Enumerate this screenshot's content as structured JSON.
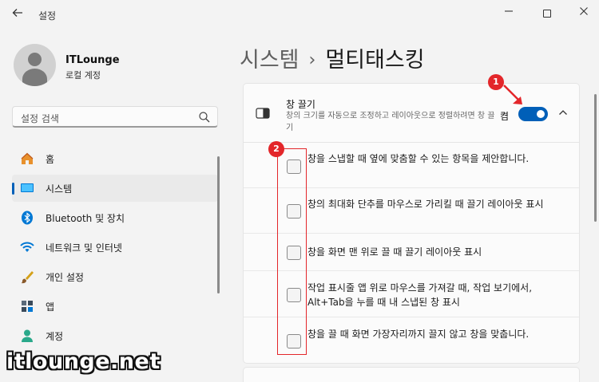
{
  "window": {
    "title": "설정"
  },
  "profile": {
    "name": "ITLounge",
    "account": "로컬 계정"
  },
  "search": {
    "placeholder": "설정 검색"
  },
  "sidebar": {
    "items": [
      {
        "label": "홈",
        "icon": "home-icon"
      },
      {
        "label": "시스템",
        "icon": "system-icon",
        "active": true
      },
      {
        "label": "Bluetooth 및 장치",
        "icon": "bluetooth-icon"
      },
      {
        "label": "네트워크 및 인터넷",
        "icon": "wifi-icon"
      },
      {
        "label": "개인 설정",
        "icon": "brush-icon"
      },
      {
        "label": "앱",
        "icon": "apps-icon"
      },
      {
        "label": "계정",
        "icon": "account-icon"
      }
    ]
  },
  "breadcrumb": {
    "parent": "시스템",
    "separator": "›",
    "current": "멀티태스킹"
  },
  "snap": {
    "title": "창 끌기",
    "description": "창의 크기를 자동으로 조정하고 레이아웃으로 정렬하려면 창 끌기",
    "toggle_label": "켬",
    "toggle_on": true
  },
  "options": [
    {
      "label": "창을 스냅할 때 옆에 맞춤할 수 있는 항목을 제안합니다.",
      "checked": false
    },
    {
      "label": "창의 최대화 단추를 마우스로 가리킬 때 끌기 레이아웃 표시",
      "checked": false
    },
    {
      "label": "창을 화면 맨 위로 끌 때 끌기 레이아웃 표시",
      "checked": false
    },
    {
      "label": "작업 표시줄 앱 위로 마우스를 가져갈 때, 작업 보기에서, Alt+Tab을 누를 때 내 스냅된 창 표시",
      "checked": false
    },
    {
      "label": "창을 끌 때 화면 가장자리까지 끌지 않고 창을 맞춥니다.",
      "checked": false
    }
  ],
  "annotations": {
    "badge1": "1",
    "badge2": "2",
    "color": "#e3262a"
  },
  "watermark": "itlounge.net",
  "colors": {
    "accent": "#005fb8",
    "background": "#f3f3f3"
  }
}
